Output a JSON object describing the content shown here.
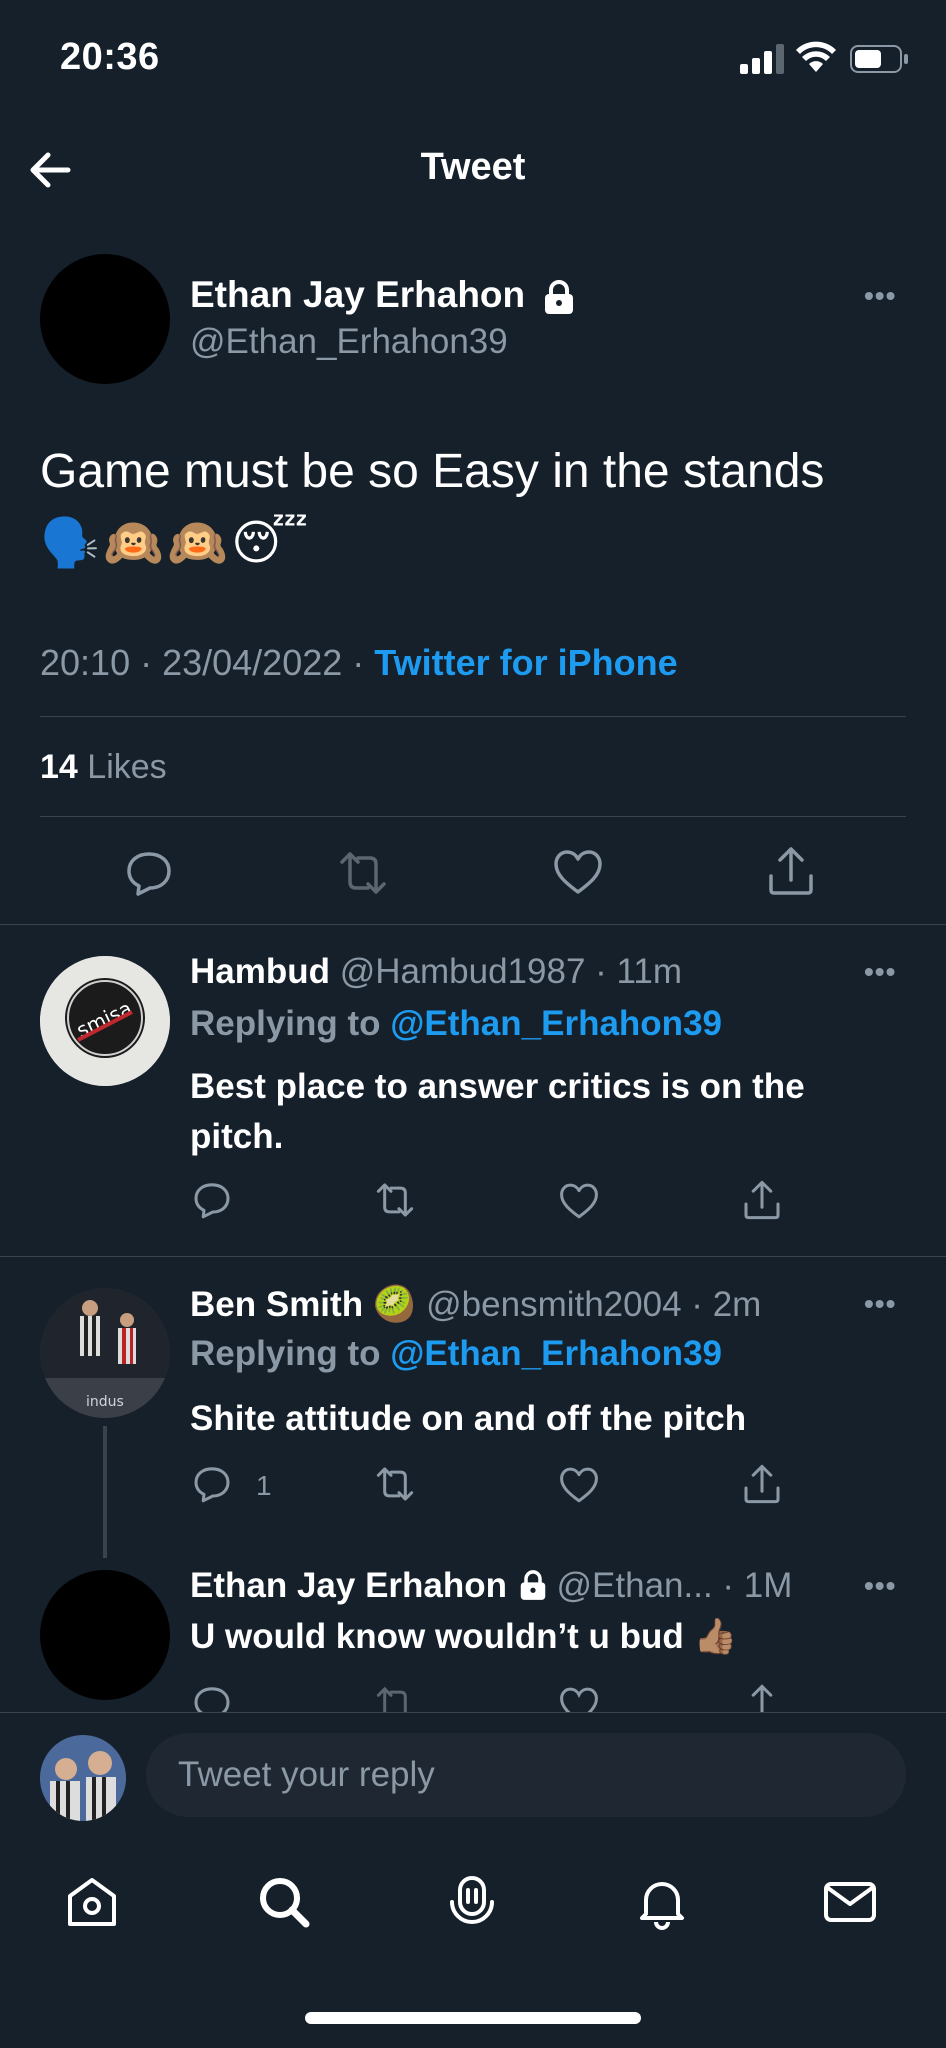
{
  "status_bar": {
    "time": "20:36"
  },
  "nav": {
    "title": "Tweet"
  },
  "main_tweet": {
    "name": "Ethan Jay Erhahon",
    "handle": "@Ethan_Erhahon39",
    "text": "Game must be so Easy in the stands",
    "emojis": "🗣️🙉🙉😴",
    "time": "20:10",
    "date": "23/04/2022",
    "source": "Twitter for iPhone",
    "likes_count": "14",
    "likes_label": "Likes",
    "more": "•••"
  },
  "replies": [
    {
      "name": "Hambud",
      "handle": "@Hambud1987",
      "age": "11m",
      "replying_prefix": "Replying to",
      "replying_to": "@Ethan_Erhahon39",
      "text": "Best place to answer critics is on the pitch.",
      "reply_count": "",
      "avatar_text": "smisa"
    },
    {
      "name": "Ben Smith",
      "badge": "🥝",
      "handle": "@bensmith2004",
      "age": "2m",
      "replying_prefix": "Replying to",
      "replying_to": "@Ethan_Erhahon39",
      "text": "Shite attitude on and off the pitch",
      "reply_count": "1",
      "avatar_text": "indus"
    },
    {
      "name": "Ethan Jay Erhahon",
      "handle": "@Ethan...",
      "age": "1M",
      "text": "U would know wouldn’t u bud 👍🏽"
    }
  ],
  "compose": {
    "placeholder": "Tweet your reply"
  },
  "tabs": [
    "home-icon",
    "search-icon",
    "spaces-icon",
    "notifications-icon",
    "messages-icon"
  ],
  "colors": {
    "background": "#15202b",
    "accent": "#1d9bf0",
    "muted": "#8b98a5",
    "divider": "#38444d"
  }
}
